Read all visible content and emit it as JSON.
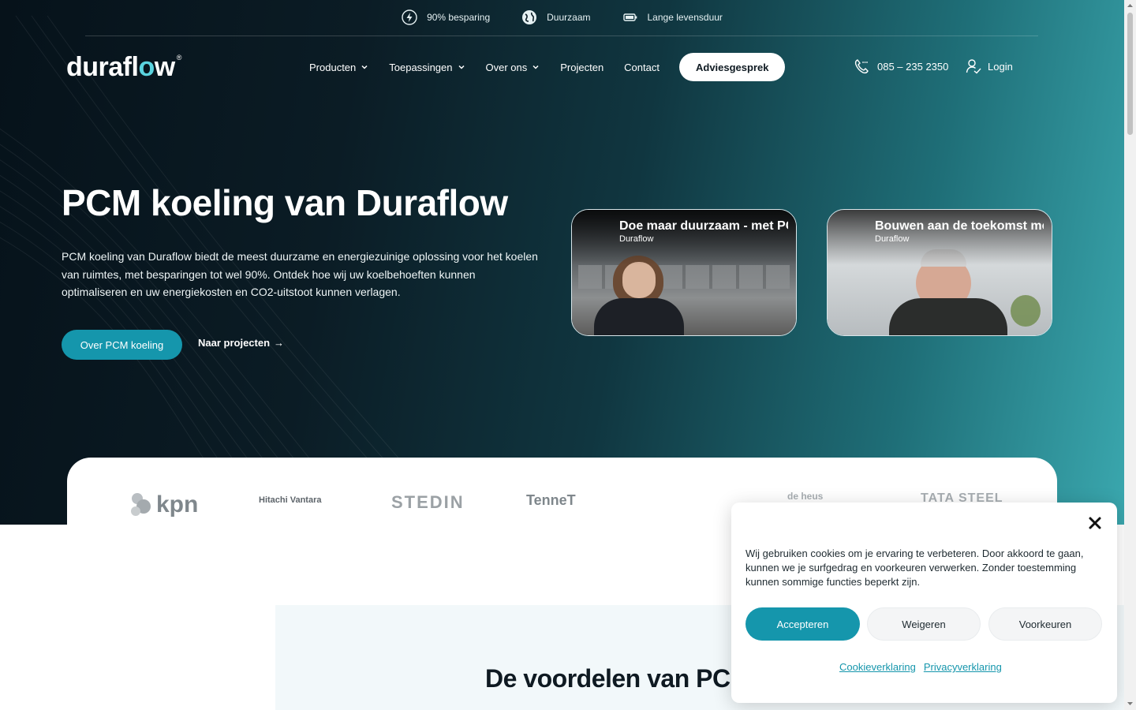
{
  "topbar": {
    "items": [
      {
        "icon": "lightning-icon",
        "label": "90% besparing"
      },
      {
        "icon": "globe-icon",
        "label": "Duurzaam"
      },
      {
        "icon": "battery-icon",
        "label": "Lange levensduur"
      }
    ]
  },
  "logo": {
    "text_main": "durafl",
    "text_accent": "o",
    "text_end": "w",
    "reg": "®"
  },
  "nav": {
    "items": [
      {
        "label": "Producten",
        "dropdown": true
      },
      {
        "label": "Toepassingen",
        "dropdown": true
      },
      {
        "label": "Over ons",
        "dropdown": true
      },
      {
        "label": "Projecten",
        "dropdown": false
      },
      {
        "label": "Contact",
        "dropdown": false
      }
    ],
    "cta": "Adviesgesprek",
    "phone": "085 – 235 2350",
    "login": "Login"
  },
  "hero": {
    "title": "PCM koeling van Duraflow",
    "text": "PCM koeling van Duraflow biedt de meest duurzame en energiezuinige oplossing voor het koelen van ruimtes, met besparingen tot wel 90%. Ontdek hoe wij uw koelbehoeften kunnen optimaliseren en uw energiekosten en CO2-uitstoot kunnen verlagen.",
    "primary_button": "Over PCM koeling",
    "link_button": "Naar projecten",
    "link_arrow": "→"
  },
  "videos": [
    {
      "title": "Doe maar duurzaam - met PCM koeling",
      "channel": "Duraflow"
    },
    {
      "title": "Bouwen aan de toekomst met Duraflow",
      "channel": "Duraflow"
    }
  ],
  "partners": [
    "kpn",
    "Hitachi Vantara",
    "STEDIN",
    "TenneT",
    "de heus",
    "TATA STEEL"
  ],
  "benefits": {
    "title": "De voordelen van PCM koeling"
  },
  "cookie": {
    "text": "Wij gebruiken cookies om je ervaring te verbeteren. Door akkoord te gaan, kunnen we je surfgedrag en voorkeuren verwerken. Zonder toestemming kunnen sommige functies beperkt zijn.",
    "accept": "Accepteren",
    "deny": "Weigeren",
    "prefs": "Voorkeuren",
    "links": [
      "Cookieverklaring",
      "Privacyverklaring"
    ]
  },
  "colors": {
    "accent": "#1596ac",
    "hero_dark": "#06121a",
    "hero_teal": "#3aa7ae"
  }
}
